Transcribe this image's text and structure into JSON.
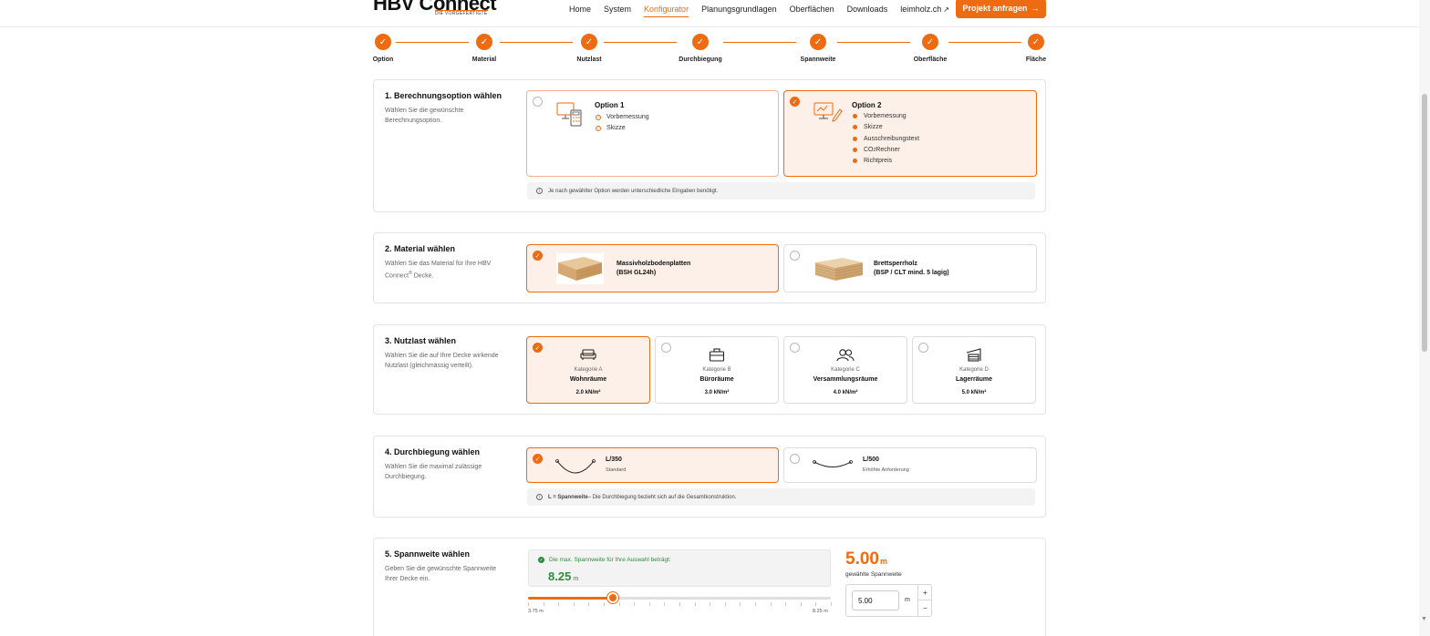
{
  "header": {
    "logo_main": "HBV Connect",
    "logo_sub": "DIE VORGEFERTIGTE",
    "nav": [
      {
        "label": "Home",
        "active": false
      },
      {
        "label": "System",
        "active": false
      },
      {
        "label": "Konfigurator",
        "active": true
      },
      {
        "label": "Planungsgrundlagen",
        "active": false
      },
      {
        "label": "Oberflächen",
        "active": false
      },
      {
        "label": "Downloads",
        "active": false
      },
      {
        "label": "leimholz.ch",
        "active": false
      }
    ],
    "cta_label": "Projekt anfragen",
    "accent": "#ee6b12"
  },
  "stepper": {
    "steps": [
      "Option",
      "Material",
      "Nutzlast",
      "Durchbiegung",
      "Spannweite",
      "Oberfläche",
      "Fläche"
    ]
  },
  "s1": {
    "title": "1. Berechnungsoption wählen",
    "desc": "Wählen Sie die gewünschte Berechnungsoption.",
    "opt1": {
      "title": "Option 1",
      "features": [
        "Vorbemessung",
        "Skizze"
      ]
    },
    "opt2": {
      "title": "Option 2",
      "features": [
        "Vorbemessung",
        "Skizze",
        "Ausschreibungstext",
        "CO",
        "Rechner",
        "Richtpreis"
      ]
    },
    "info": "Je nach gewählter Option werden unterschiedliche Eingaben benötigt."
  },
  "s2": {
    "title": "2. Material wählen",
    "desc1": "Wählen Sie das Material für Ihre HBV Connect",
    "desc2": " Decke.",
    "reg": "®",
    "m1": {
      "line1": "Massivholzbodenplatten",
      "line2": "(BSH GL24h)"
    },
    "m2": {
      "line1": "Brettsperrholz",
      "line2": "(BSP / CLT mind. 5 lagig)"
    }
  },
  "s3": {
    "title": "3. Nutzlast wählen",
    "desc": "Wählen Sie die auf Ihre Decke wirkende Nutzlast (gleichmässig verteilt).",
    "loads": [
      {
        "cat": "Kategorie A",
        "name": "Wohnräume",
        "value": "2.0 kN/m²",
        "icon": "sofa-icon"
      },
      {
        "cat": "Kategorie B",
        "name": "Büroräume",
        "value": "3.0 kN/m²",
        "icon": "briefcase-icon"
      },
      {
        "cat": "Kategorie C",
        "name": "Versammlungsräume",
        "value": "4.0 kN/m²",
        "icon": "people-icon"
      },
      {
        "cat": "Kategorie D",
        "name": "Lagerräume",
        "value": "5.0 kN/m²",
        "icon": "warehouse-icon"
      }
    ]
  },
  "s4": {
    "title": "4. Durchbiegung wählen",
    "desc": "Wählen Sie die maximal zulässige Durchbiegung.",
    "d1": {
      "title": "L/350",
      "sub": "Standard"
    },
    "d2": {
      "title": "L/500",
      "sub": "Erhöhte Anforderung"
    },
    "info_bold": "L = Spannweite",
    "info_rest": " – Die Durchbiegung bezieht sich auf die Gesamtkonstruktion."
  },
  "s5": {
    "title": "5. Spannweite wählen",
    "desc": "Geben Sie die gewünschte Spannweite Ihrer Decke ein.",
    "max_msg": "Die max. Spannweite für Ihre Auswahl beträgt:",
    "max_value": "8.25",
    "unit": "m",
    "slider_min": "3.75 m",
    "slider_max": "8.25 m",
    "slider_fraction": 0.28,
    "selected_value": "5.00",
    "selected_label": "gewählte Spannweite",
    "input_value": "5.00",
    "plus": "+",
    "minus": "−"
  }
}
